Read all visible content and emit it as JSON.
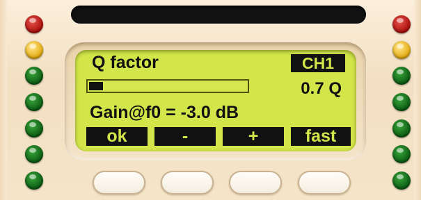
{
  "display": {
    "title": "Q factor",
    "channel": "CH1",
    "q_value": "0.7 Q",
    "gain_text": "Gain@f0 = -3.0 dB",
    "meter_level": 0.09
  },
  "softkeys": [
    "ok",
    "-",
    "+",
    "fast"
  ],
  "leds": {
    "left": [
      "red",
      "yellow",
      "green",
      "green",
      "green",
      "green",
      "green"
    ],
    "right": [
      "red",
      "yellow",
      "green",
      "green",
      "green",
      "green",
      "green"
    ]
  },
  "colors": {
    "lcd_background": "#d2e64a",
    "lcd_ink": "#111111",
    "panel": "#f7e7cc"
  }
}
